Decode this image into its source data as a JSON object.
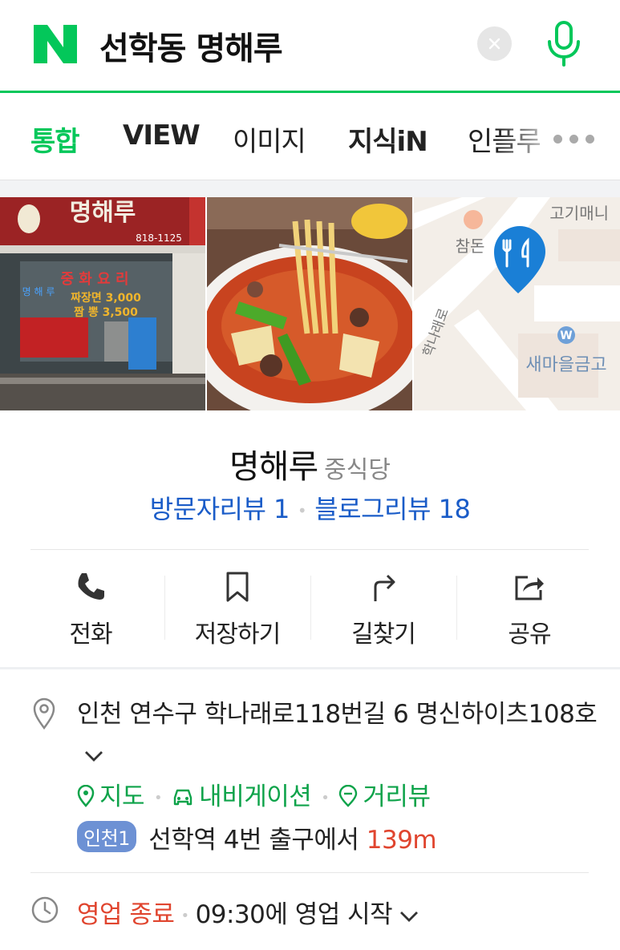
{
  "search": {
    "query": "선학동 명해루"
  },
  "tabs": [
    {
      "label": "통합"
    },
    {
      "label": "VIEW"
    },
    {
      "label": "이미지"
    },
    {
      "label": "지식iN"
    },
    {
      "label": "인플루"
    }
  ],
  "photos": {
    "storefront": {
      "sign_text": "명해루",
      "sign_phone": "818-1125",
      "window_title": "중 화 요 리",
      "window_side": "명 해 루",
      "window_menu": [
        "짜장면 3,000",
        "짬  뽕 3,500"
      ]
    },
    "map": {
      "labels": [
        "고기매니",
        "참돈",
        "학나래로",
        "새마을금고"
      ],
      "marker_icon": "utensils-icon"
    }
  },
  "place": {
    "name": "명해루",
    "category": "중식당",
    "visitor_reviews": "방문자리뷰 1",
    "blog_reviews": "블로그리뷰 18"
  },
  "actions": [
    {
      "label": "전화",
      "icon": "phone-icon"
    },
    {
      "label": "저장하기",
      "icon": "bookmark-icon"
    },
    {
      "label": "길찾기",
      "icon": "directions-icon"
    },
    {
      "label": "공유",
      "icon": "share-icon"
    }
  ],
  "info": {
    "address": "인천 연수구 학나래로118번길 6 명신하이츠108호",
    "links": [
      {
        "label": "지도",
        "icon": "pin-outline-icon"
      },
      {
        "label": "내비게이션",
        "icon": "car-icon"
      },
      {
        "label": "거리뷰",
        "icon": "streetview-icon"
      }
    ],
    "subway": {
      "line": "인천1",
      "station": "선학역",
      "exit_text": "4번 출구에서",
      "distance": "139m"
    },
    "hours": {
      "status": "영업 종료",
      "next": "09:30에 영업 시작"
    }
  },
  "colors": {
    "brand_green": "#03c75a",
    "link_blue": "#1a5cc8",
    "alert_red": "#e0452f",
    "line1_blue": "#6d91d4"
  }
}
